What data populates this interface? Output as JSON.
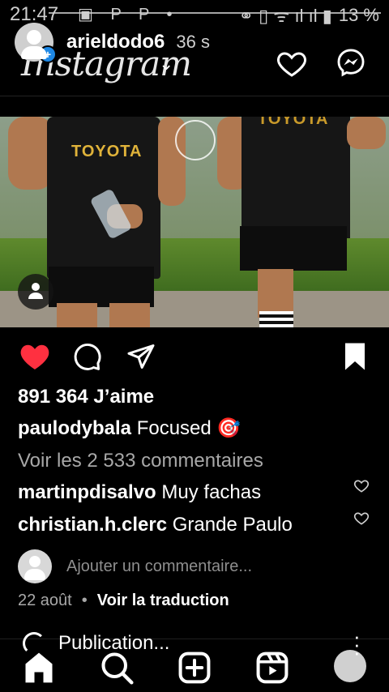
{
  "status_bar": {
    "time": "21:47",
    "app_icons": "▣ P P •",
    "right_icons": "⚭ ▯ ᯤ ıl ıl ▮",
    "battery": "13 %"
  },
  "story": {
    "username": "arieldodo6",
    "time_ago": "36 s",
    "badge": "+"
  },
  "header": {
    "logo": "Instagram",
    "dropdown_icon": "chevron-down-icon",
    "icons": [
      "heart-icon",
      "messenger-icon"
    ]
  },
  "post": {
    "image_texts": {
      "sponsor_left": "TOYOTA",
      "sponsor_right": "TOYOTA"
    },
    "liked": true,
    "likes_label": "891 364 J’aime",
    "author": "paulodybala",
    "caption": "Focused 🎯",
    "view_comments": "Voir les 2 533 commentaires",
    "comments": [
      {
        "user": "martinpdisalvo",
        "text": "Muy fachas"
      },
      {
        "user": "christian.h.clerc",
        "text": "Grande Paulo"
      }
    ],
    "add_comment_placeholder": "Ajouter un commentaire...",
    "date": "22 août",
    "translate": "Voir la traduction"
  },
  "toast": {
    "text": "Publication..."
  },
  "nav": {
    "items": [
      "home-icon",
      "search-icon",
      "create-icon",
      "reels-icon",
      "profile-icon"
    ]
  },
  "colors": {
    "like_red": "#ff3040",
    "background": "#000000",
    "muted_text": "#a8a8a8"
  }
}
